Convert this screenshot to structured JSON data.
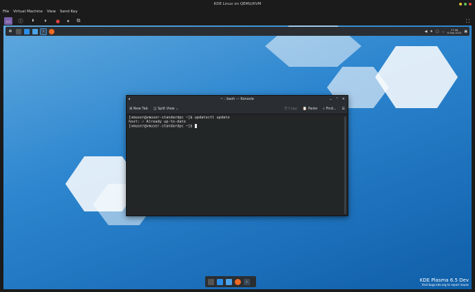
{
  "window": {
    "title": "KDE Linux on QEMU/KVM",
    "menu": [
      "File",
      "Virtual Machine",
      "View",
      "Send Key"
    ]
  },
  "toolbar": {
    "icons": [
      "display-icon",
      "details-icon",
      "play-icon",
      "pause-icon",
      "shutdown-icon",
      "dropdown-icon",
      "snapshot-icon"
    ],
    "fullscreen_icon": "fullscreen-icon"
  },
  "panel": {
    "time": "17:58",
    "date": "6 Sep 2025"
  },
  "konsole": {
    "title": "~ : bash — Konsole",
    "new_tab": "New Tab",
    "split_view": "Split View",
    "copy": "Copy",
    "paste": "Paste",
    "find": "Find...",
    "lines": [
      "[vmuser@vmuser-standardpc ~]$ updatectl update",
      "host: ✓ Already up-to-date",
      "[vmuser@vmuser-standardpc ~]$ "
    ]
  },
  "branding": {
    "title": "KDE Plasma 6.5 Dev",
    "subtitle": "Visit bugs.kde.org to report issues"
  },
  "colors": {
    "accent": "#7a5fa8",
    "panel": "#2a2e32",
    "terminal_bg": "#232627"
  }
}
